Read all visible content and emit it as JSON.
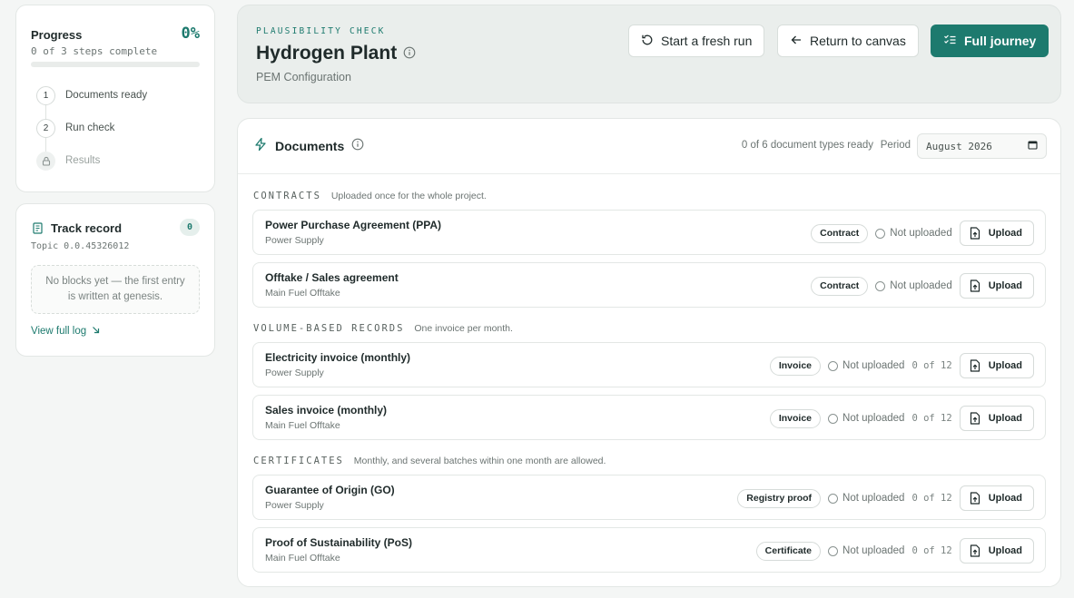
{
  "progress": {
    "title": "Progress",
    "percent_label": "0%",
    "percent_value": 0,
    "subtitle": "0 of 3 steps complete",
    "steps": [
      {
        "num": "1",
        "label": "Documents ready"
      },
      {
        "num": "2",
        "label": "Run check"
      },
      {
        "num": "",
        "label": "Results",
        "icon": "lock-icon"
      }
    ]
  },
  "track_record": {
    "title": "Track record",
    "badge": "0",
    "topic": "Topic 0.0.45326012",
    "empty_text": "No blocks yet — the first entry is written at genesis.",
    "link": "View full log",
    "link_icon": "arrow-down-right-icon"
  },
  "header": {
    "eyebrow": "PLAUSIBILITY CHECK",
    "title": "Hydrogen Plant",
    "subtitle": "PEM Configuration",
    "buttons": {
      "fresh_run": "Start a fresh run",
      "return": "Return to canvas",
      "journey": "Full journey"
    }
  },
  "documents": {
    "title": "Documents",
    "ready_text": "0 of 6 document types ready",
    "period_label": "Period",
    "period_value": "August 2026",
    "sections": [
      {
        "name": "CONTRACTS",
        "description": "Uploaded once for the whole project.",
        "rows": [
          {
            "title": "Power Purchase Agreement (PPA)",
            "subtitle": "Power Supply",
            "tag": "Contract",
            "status": "Not uploaded",
            "count": "",
            "action": "Upload"
          },
          {
            "title": "Offtake / Sales agreement",
            "subtitle": "Main Fuel Offtake",
            "tag": "Contract",
            "status": "Not uploaded",
            "count": "",
            "action": "Upload"
          }
        ]
      },
      {
        "name": "VOLUME-BASED RECORDS",
        "description": "One invoice per month.",
        "rows": [
          {
            "title": "Electricity invoice (monthly)",
            "subtitle": "Power Supply",
            "tag": "Invoice",
            "status": "Not uploaded",
            "count": "0 of 12",
            "action": "Upload"
          },
          {
            "title": "Sales invoice (monthly)",
            "subtitle": "Main Fuel Offtake",
            "tag": "Invoice",
            "status": "Not uploaded",
            "count": "0 of 12",
            "action": "Upload"
          }
        ]
      },
      {
        "name": "CERTIFICATES",
        "description": "Monthly, and several batches within one month are allowed.",
        "rows": [
          {
            "title": "Guarantee of Origin (GO)",
            "subtitle": "Power Supply",
            "tag": "Registry proof",
            "status": "Not uploaded",
            "count": "0 of 12",
            "action": "Upload"
          },
          {
            "title": "Proof of Sustainability (PoS)",
            "subtitle": "Main Fuel Offtake",
            "tag": "Certificate",
            "status": "Not uploaded",
            "count": "0 of 12",
            "action": "Upload"
          }
        ]
      }
    ]
  },
  "colors": {
    "accent": "#1d7a6e",
    "background": "#f4f6f5",
    "header_bg": "#eaeeec"
  }
}
